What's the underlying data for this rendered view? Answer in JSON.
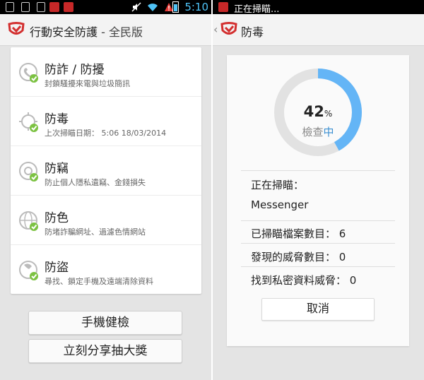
{
  "left": {
    "status_bar": {
      "time": "5:10"
    },
    "header": {
      "title": "行動安全防護",
      "subtitle": "- 全民版"
    },
    "items": [
      {
        "title": "防詐 / 防擾",
        "desc": "封鎖騷擾來電與垃圾簡訊",
        "icon": "phone-shield-icon"
      },
      {
        "title": "防毒",
        "desc": "上次掃瞄日期： 5:06 18/03/2014",
        "icon": "virus-icon"
      },
      {
        "title": "防竊",
        "desc": "防止個人隱私遺竊、金錢損失",
        "icon": "safe-icon"
      },
      {
        "title": "防色",
        "desc": "防堵詐騙網址、過濾色情網站",
        "icon": "globe-icon"
      },
      {
        "title": "防盜",
        "desc": "尋找、鎖定手機及遠端清除資料",
        "icon": "lock-phone-icon"
      }
    ],
    "buttons": {
      "health_check": "手機健檢",
      "share": "立刻分享抽大獎"
    }
  },
  "right": {
    "status_bar": {
      "notification": "正在掃瞄..."
    },
    "header": {
      "title": "防毒"
    },
    "scan": {
      "percent": "42",
      "percent_unit": "%",
      "progress": 0.42,
      "state_prefix": "檢查",
      "state_highlight": "中",
      "scanning_label": "正在掃瞄：",
      "current_item": "Messenger",
      "files_label": "已掃瞄檔案數目：",
      "files_count": "6",
      "threats_label": "發現的威脅數目：",
      "threats_count": "0",
      "privacy_label": "找到私密資料威脅：",
      "privacy_count": "0",
      "cancel": "取消"
    }
  },
  "colors": {
    "accent": "#64b5f6",
    "check": "#7cc242",
    "brand_red": "#d32f2f",
    "track": "#e2e2e2"
  }
}
